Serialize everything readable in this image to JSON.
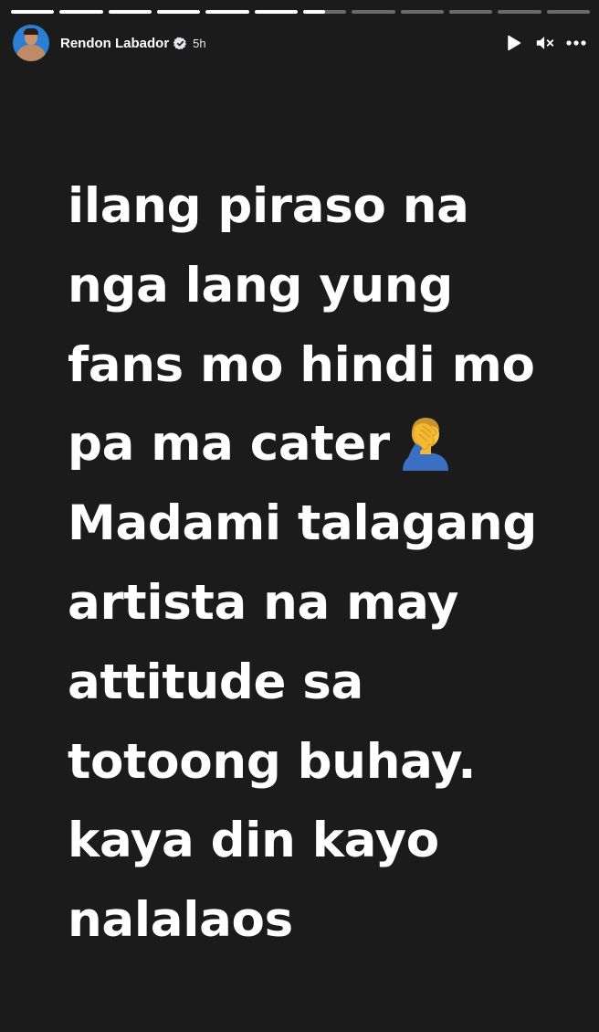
{
  "progress": {
    "segment_count": 12,
    "completed_segments": 6,
    "current_segment_fraction": 0.5
  },
  "author": {
    "name": "Rendon Labador",
    "verified": true,
    "time_ago": "5h"
  },
  "controls": {
    "play_icon": "play-icon",
    "mute_icon": "volume-muted-icon",
    "more_icon": "more-options-icon"
  },
  "story": {
    "background_color": "#1b1b1b",
    "text_color": "#ffffff",
    "lines": [
      "ilang piraso na",
      "nga lang yung",
      "fans mo hindi mo",
      "pa ma cater",
      "Madami talagang",
      "artista na may",
      "attitude sa",
      "totoong buhay.",
      "kaya din kayo",
      "nalalaos"
    ],
    "emoji": {
      "name": "person-facepalming",
      "after_line": 4
    }
  }
}
